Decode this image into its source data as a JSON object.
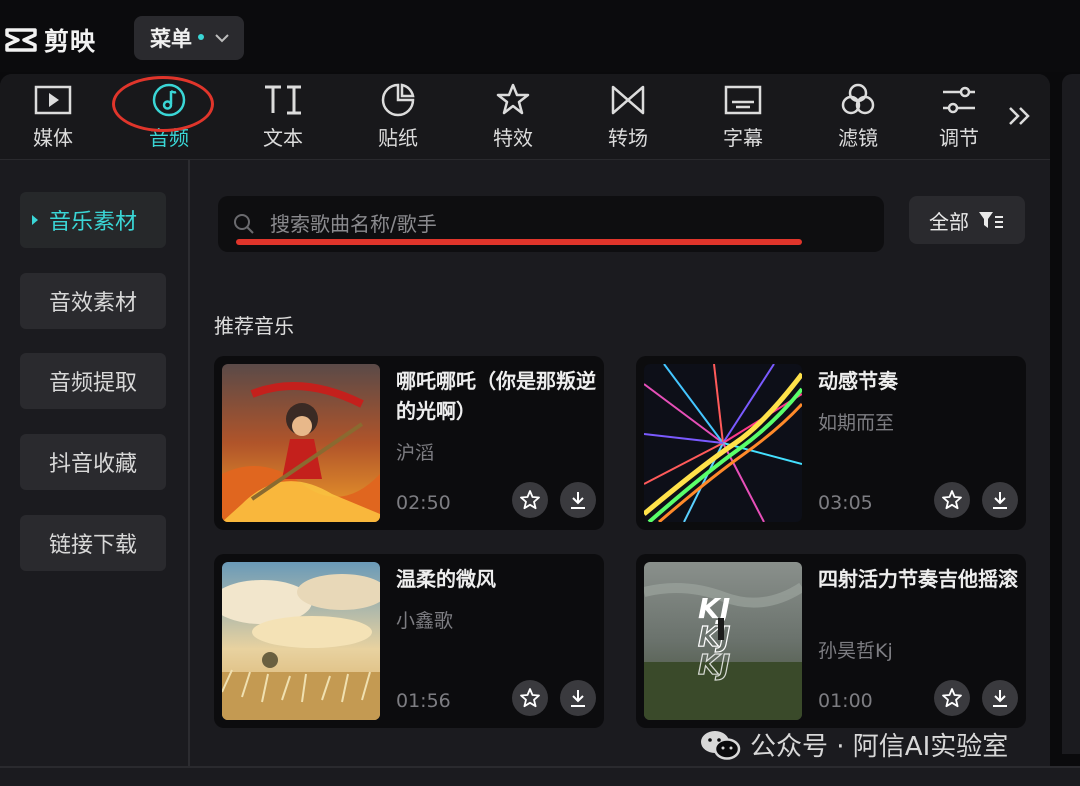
{
  "app": {
    "name": "剪映"
  },
  "menu": {
    "label": "菜单"
  },
  "toolbar": {
    "tabs": [
      {
        "label": "媒体",
        "icon": "media-icon"
      },
      {
        "label": "音频",
        "icon": "audio-note-icon",
        "active": true
      },
      {
        "label": "文本",
        "icon": "text-icon"
      },
      {
        "label": "贴纸",
        "icon": "sticker-icon"
      },
      {
        "label": "特效",
        "icon": "effects-star-icon"
      },
      {
        "label": "转场",
        "icon": "transition-icon"
      },
      {
        "label": "字幕",
        "icon": "subtitle-icon"
      },
      {
        "label": "滤镜",
        "icon": "filter-circles-icon"
      },
      {
        "label": "调节",
        "icon": "adjust-sliders-icon"
      }
    ],
    "more": "double-chevron-right-icon"
  },
  "sidebar": {
    "items": [
      {
        "label": "音乐素材",
        "active": true
      },
      {
        "label": "音效素材"
      },
      {
        "label": "音频提取"
      },
      {
        "label": "抖音收藏"
      },
      {
        "label": "链接下载"
      }
    ]
  },
  "search": {
    "placeholder": "搜索歌曲名称/歌手",
    "value": ""
  },
  "filter": {
    "label": "全部"
  },
  "section": {
    "title": "推荐音乐"
  },
  "tracks": [
    {
      "title": "哪吒哪吒（你是那叛逆的光啊）",
      "artist": "沪滔",
      "duration": "02:50"
    },
    {
      "title": "动感节奏",
      "artist": "如期而至",
      "duration": "03:05"
    },
    {
      "title": "温柔的微风",
      "artist": "小鑫歌",
      "duration": "01:56"
    },
    {
      "title": "四射活力节奏吉他摇滚",
      "artist": "孙昊哲Kj",
      "duration": "01:00",
      "cover_text": "KJ"
    }
  ],
  "watermark": {
    "text": "公众号 · 阿信AI实验室"
  },
  "colors": {
    "accent": "#3ad6d6",
    "annotation": "#e0352b",
    "panel": "#1b1b1f",
    "card": "#0c0c0e"
  }
}
